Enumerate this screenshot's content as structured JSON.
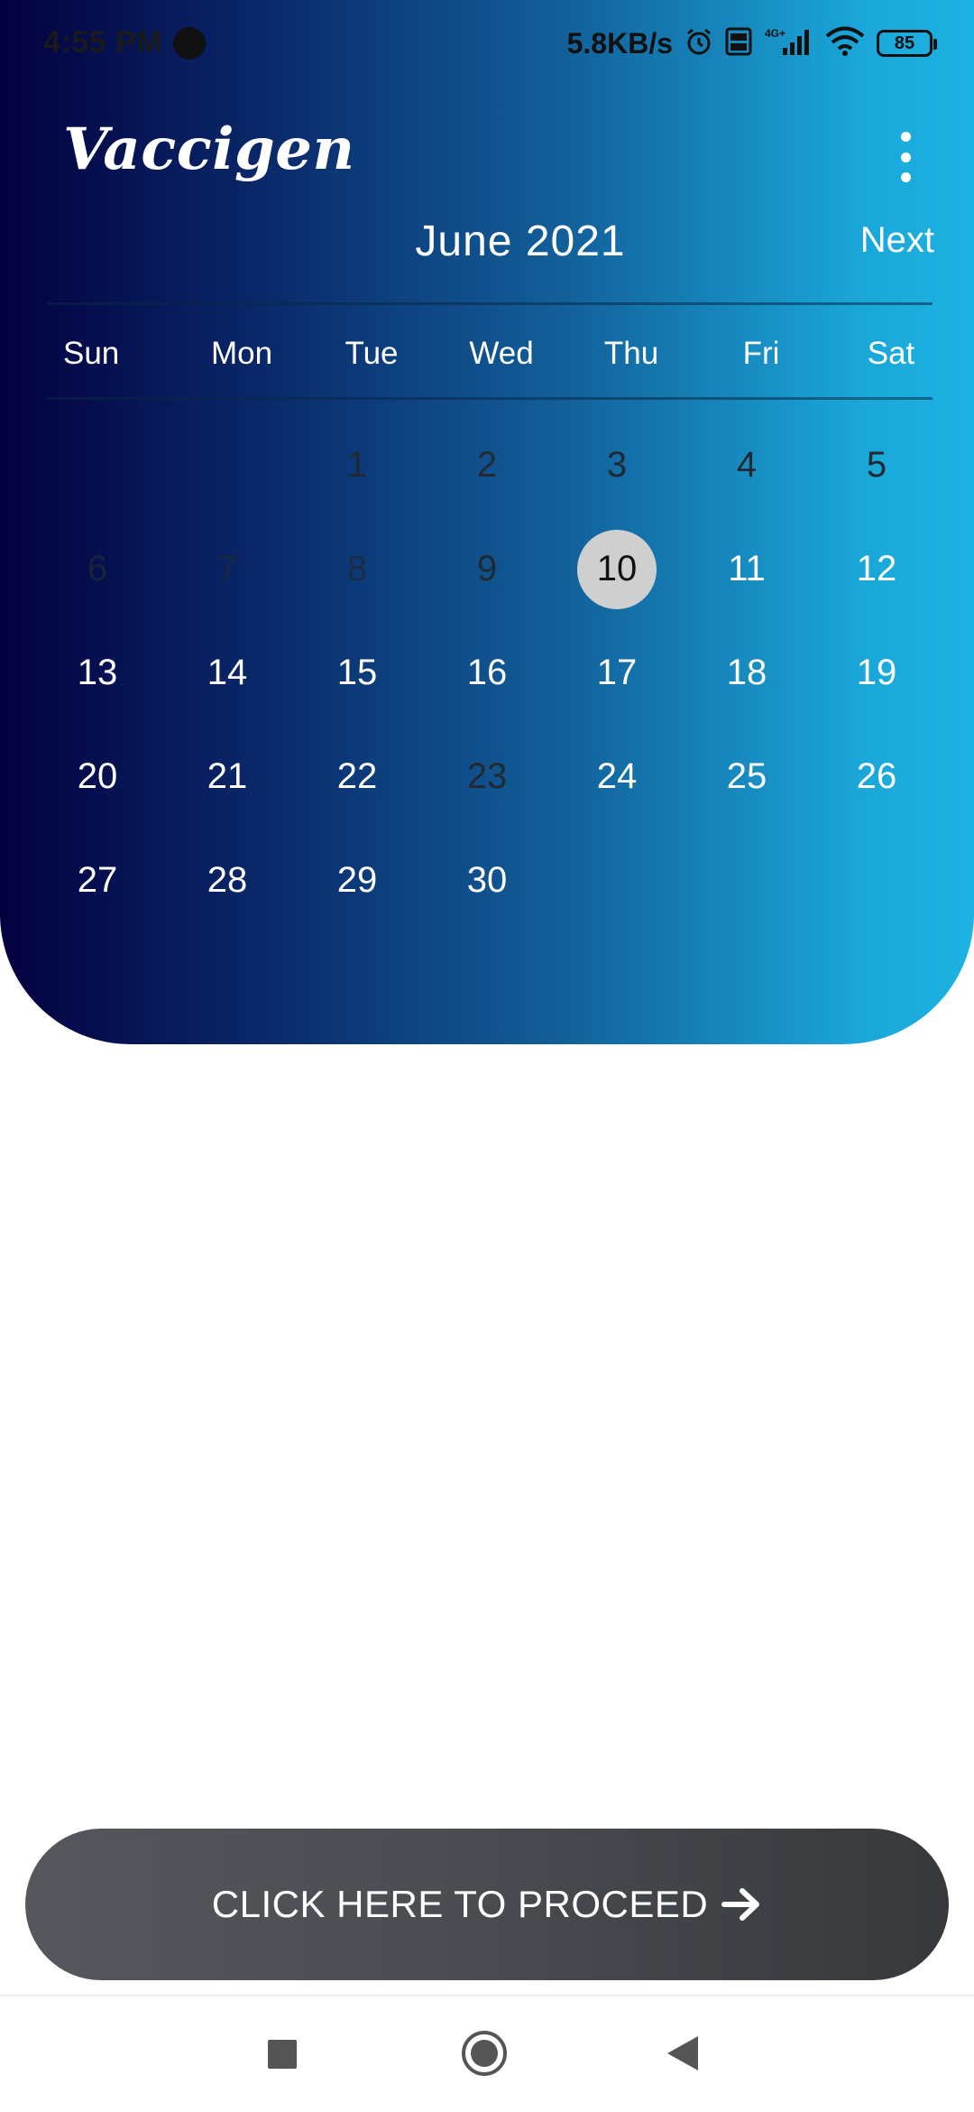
{
  "status_bar": {
    "time": "4:55 PM",
    "net_speed": "5.8KB/s",
    "battery": "85",
    "network": "4G+"
  },
  "app": {
    "title": "Vaccigen",
    "menu_icon": "more-vert-icon"
  },
  "calendar": {
    "month_title": "June 2021",
    "next_label": "Next",
    "weekdays": [
      "Sun",
      "Mon",
      "Tue",
      "Wed",
      "Thu",
      "Fri",
      "Sat"
    ],
    "leading_blanks": 2,
    "days": [
      {
        "label": "1",
        "state": "disabled"
      },
      {
        "label": "2",
        "state": "disabled"
      },
      {
        "label": "3",
        "state": "disabled"
      },
      {
        "label": "4",
        "state": "disabled"
      },
      {
        "label": "5",
        "state": "disabled"
      },
      {
        "label": "6",
        "state": "disabled-faded"
      },
      {
        "label": "7",
        "state": "disabled-faded"
      },
      {
        "label": "8",
        "state": "disabled-faded"
      },
      {
        "label": "9",
        "state": "disabled"
      },
      {
        "label": "10",
        "state": "selected"
      },
      {
        "label": "11",
        "state": "available"
      },
      {
        "label": "12",
        "state": "available"
      },
      {
        "label": "13",
        "state": "available"
      },
      {
        "label": "14",
        "state": "available"
      },
      {
        "label": "15",
        "state": "available"
      },
      {
        "label": "16",
        "state": "available"
      },
      {
        "label": "17",
        "state": "available"
      },
      {
        "label": "18",
        "state": "available"
      },
      {
        "label": "19",
        "state": "available"
      },
      {
        "label": "20",
        "state": "available"
      },
      {
        "label": "21",
        "state": "available"
      },
      {
        "label": "22",
        "state": "available"
      },
      {
        "label": "23",
        "state": "disabled"
      },
      {
        "label": "24",
        "state": "available"
      },
      {
        "label": "25",
        "state": "available"
      },
      {
        "label": "26",
        "state": "available"
      },
      {
        "label": "27",
        "state": "available"
      },
      {
        "label": "28",
        "state": "available"
      },
      {
        "label": "29",
        "state": "available"
      },
      {
        "label": "30",
        "state": "available"
      }
    ]
  },
  "proceed": {
    "label": "CLICK HERE TO PROCEED",
    "icon": "arrow-right-icon"
  },
  "colors": {
    "gradient_start": "#03003f",
    "gradient_end": "#1cb3e2",
    "selected_day_bg": "#cfcfcf",
    "button_bg": "#4a4d52"
  }
}
